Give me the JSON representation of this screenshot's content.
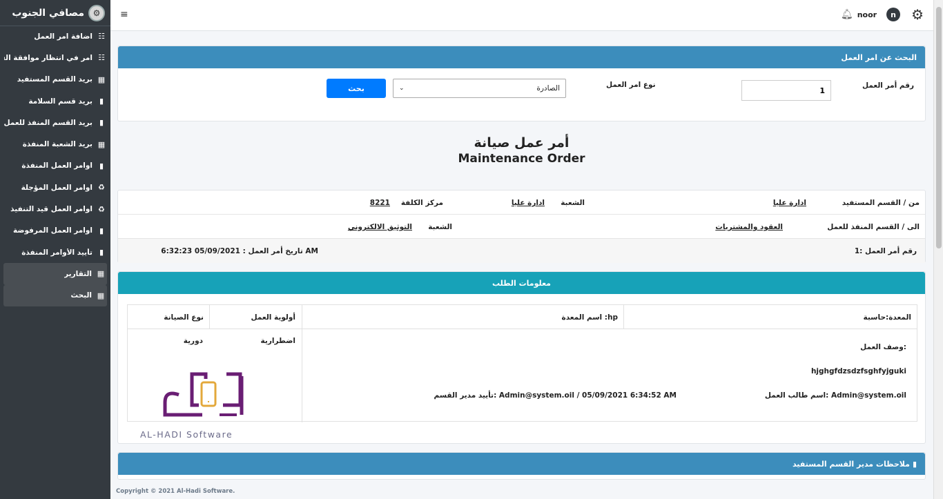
{
  "brand": {
    "title": "مصافي الجنوب"
  },
  "sidebar": {
    "items": [
      {
        "label": "اضافة امر العمل",
        "icon": "☷"
      },
      {
        "label": "امر في انتظار موافقة القسم",
        "icon": "☷"
      },
      {
        "label": "بريد القسم المستفيد",
        "icon": "▦"
      },
      {
        "label": "بريد قسم السلامة",
        "icon": "▮"
      },
      {
        "label": "بريد القسم المنفذ للعمل",
        "icon": "▮"
      },
      {
        "label": "بريد الشعبة المنفذة",
        "icon": "▦"
      },
      {
        "label": "اوامر العمل المنفذة",
        "icon": "▮"
      },
      {
        "label": "اوامر العمل المؤجلة",
        "icon": "♻"
      },
      {
        "label": "اوامر العمل قيد التنفيذ",
        "icon": "♻"
      },
      {
        "label": "اوامر العمل المرفوضة",
        "icon": "▮"
      },
      {
        "label": "تأييد الأوامر المنفذة",
        "icon": "▮"
      },
      {
        "label": "التقارير",
        "icon": "▦"
      },
      {
        "label": "البحث",
        "icon": "▦"
      }
    ]
  },
  "topbar": {
    "username": "noor",
    "avatar_letter": "n",
    "hamburger": "≡"
  },
  "search": {
    "title": "البحث عن امر العمل",
    "order_number_label": "رقم أمر العمل",
    "order_number_value": "1",
    "order_type_label": "نوع امر العمل",
    "order_type_selected": "الصادرة",
    "search_button": "بحث"
  },
  "document": {
    "title_ar": "أمر عمل صيانة",
    "title_en": "Maintenance Order"
  },
  "order_info": {
    "from_label": "من / القسم المستفيد",
    "from_value": "ادارة عليا",
    "from_branch_label": "الشعبة",
    "from_branch_value": "ادارة عليا",
    "cost_center_label": "مركز الكلفة",
    "cost_center_value": "8221",
    "to_label": "الى / القسم المنفذ للعمل",
    "to_value": "العقود والمشتريات",
    "to_branch_label": "الشعبة",
    "to_branch_value": "التوثيق الالكتروني",
    "order_no_text": "رقم أمر العمل :1",
    "order_date_text": "تاريخ أمر العمل : 05/09/2021 6:32:23 AM"
  },
  "request_info": {
    "title": "معلومات الطلب",
    "equipment": "المعدة:حاسبة",
    "equipment_name": "اسم المعدة :hp",
    "priority_label": "أولوية العمل",
    "maintenance_type_label": "نوع الصيانة",
    "description_label": "وصف العمل:",
    "description_value": "hjghgfdzsdzfsghfyjguki",
    "requester_text": "اسم طالب العمل: Admin@system.oil",
    "approval_text": "تأييد مدير القسم: Admin@system.oil / 05/09/2021 6:34:52 AM",
    "priority_value": "اضطرارية",
    "maintenance_type_value": "دورية"
  },
  "watermark": {
    "text": "AL-HADI Software"
  },
  "notes": {
    "title": "ملاحظات مدير القسم المستفيد"
  },
  "footer": {
    "copyright": "Copyright © 2021 Al-Hadi Software."
  },
  "colors": {
    "sidebar": "#343a40",
    "header_blue": "#3c8dbc",
    "header_teal": "#17a2b8",
    "button": "#007bff",
    "logo_purple": "#6a1e74",
    "logo_gold": "#e3a83b"
  }
}
